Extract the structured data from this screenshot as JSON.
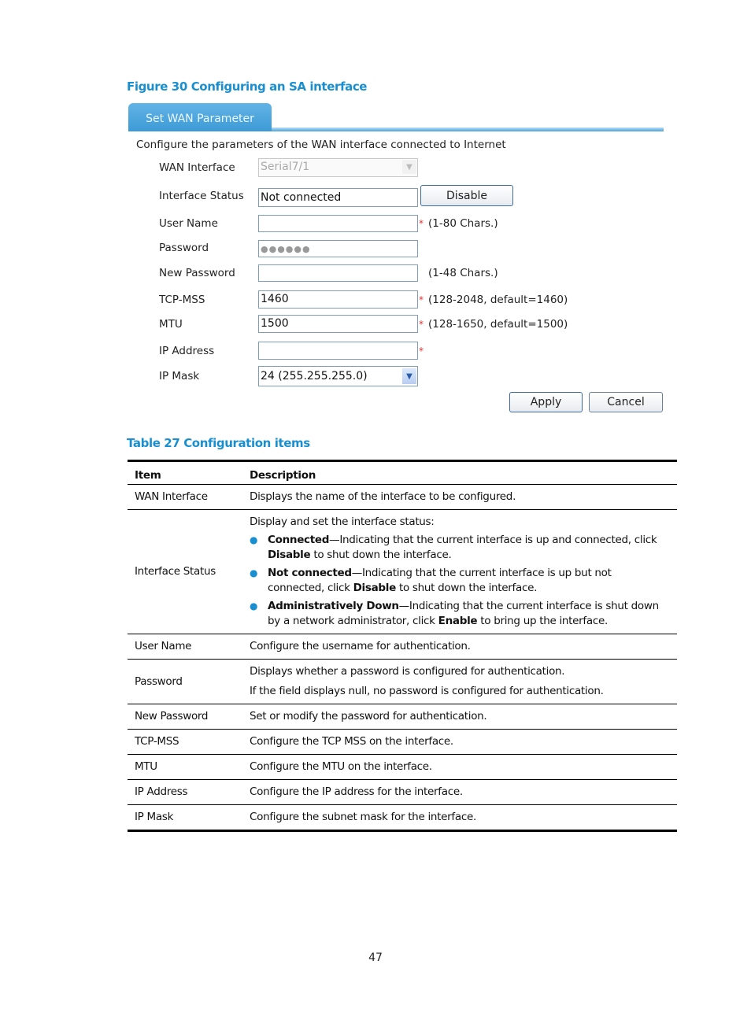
{
  "figure_caption": "Figure 30 Configuring an SA interface",
  "ui": {
    "tab_label": "Set WAN Parameter",
    "intro": "Configure the parameters of the WAN interface connected to Internet",
    "fields": {
      "wan_interface": {
        "label": "WAN Interface",
        "value": "Serial7/1"
      },
      "interface_status": {
        "label": "Interface Status",
        "value": "Not connected",
        "button": "Disable"
      },
      "user_name": {
        "label": "User Name",
        "value": "",
        "required": "*",
        "hint": "(1-80 Chars.)"
      },
      "password": {
        "label": "Password",
        "value": "●●●●●●"
      },
      "new_password": {
        "label": "New Password",
        "value": "",
        "hint": "(1-48 Chars.)"
      },
      "tcp_mss": {
        "label": "TCP-MSS",
        "value": "1460",
        "required": "*",
        "hint": "(128-2048, default=1460)"
      },
      "mtu": {
        "label": "MTU",
        "value": "1500",
        "required": "*",
        "hint": "(128-1650, default=1500)"
      },
      "ip_address": {
        "label": "IP Address",
        "value": "",
        "required": "*"
      },
      "ip_mask": {
        "label": "IP Mask",
        "value": "24 (255.255.255.0)"
      }
    },
    "buttons": {
      "apply": "Apply",
      "cancel": "Cancel"
    },
    "icons": {
      "dropdown": "▼"
    }
  },
  "table_caption": "Table 27 Configuration items",
  "table": {
    "headers": {
      "item": "Item",
      "description": "Description"
    },
    "rows": {
      "wan_interface": {
        "item": "WAN Interface",
        "desc": "Displays the name of the interface to be configured."
      },
      "interface_status": {
        "item": "Interface Status",
        "intro": "Display and set the interface status:",
        "bullets": [
          {
            "term": "Connected",
            "text1": "—Indicating that the current interface is up and connected, click ",
            "bold2": "Disable",
            "text2": " to shut down the interface."
          },
          {
            "term": "Not connected",
            "text1": "—Indicating that the current interface is up but not connected, click ",
            "bold2": "Disable",
            "text2": " to shut down the interface."
          },
          {
            "term": "Administratively Down",
            "text1": "—Indicating that the current interface is shut down by a network administrator, click ",
            "bold2": "Enable",
            "text2": " to bring up the interface."
          }
        ]
      },
      "user_name": {
        "item": "User Name",
        "desc": "Configure the username for authentication."
      },
      "password": {
        "item": "Password",
        "desc1": "Displays whether a password is configured for authentication.",
        "desc2": "If the field displays null, no password is configured for authentication."
      },
      "new_password": {
        "item": "New Password",
        "desc": "Set or modify the password for authentication."
      },
      "tcp_mss": {
        "item": "TCP-MSS",
        "desc": "Configure the TCP MSS on the interface."
      },
      "mtu": {
        "item": "MTU",
        "desc": "Configure the MTU on the interface."
      },
      "ip_address": {
        "item": "IP Address",
        "desc": "Configure the IP address for the interface."
      },
      "ip_mask": {
        "item": "IP Mask",
        "desc": "Configure the subnet mask for the interface."
      }
    }
  },
  "page_number": "47",
  "colors": {
    "caption_blue": "#1a8fd0",
    "tab_blue": "#3d9ad6",
    "required_red": "#d33333"
  }
}
